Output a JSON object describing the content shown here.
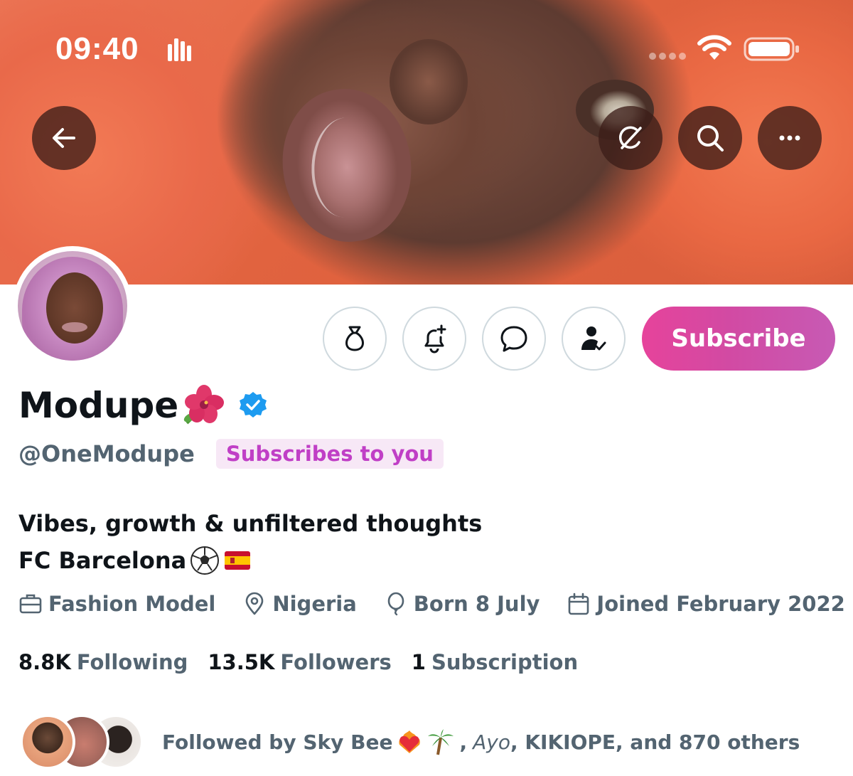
{
  "status_bar": {
    "time": "09:40"
  },
  "header": {
    "back_icon": "arrow-left-icon",
    "actions": [
      "grok-icon",
      "search-icon",
      "more-horizontal-icon"
    ]
  },
  "actions": {
    "tip_icon": "money-bag-icon",
    "notify_icon": "bell-plus-icon",
    "message_icon": "chat-bubble-icon",
    "follow_icon": "person-check-icon",
    "subscribe_label": "Subscribe"
  },
  "profile": {
    "display_name": "Modupe",
    "name_emoji": "hibiscus-icon",
    "verified": true,
    "handle": "@OneModupe",
    "badge": "Subscribes to you",
    "bio_line1": "Vibes, growth & unfiltered thoughts",
    "bio_line2": "FC Barcelona"
  },
  "meta": {
    "profession": "Fashion Model",
    "location": "Nigeria",
    "birthday": "Born 8 July",
    "joined": "Joined February 2022"
  },
  "stats": {
    "following_count": "8.8K",
    "following_label": "Following",
    "followers_count": "13.5K",
    "followers_label": "Followers",
    "subscriptions_count": "1",
    "subscriptions_label": "Subscription"
  },
  "followed_by": {
    "prefix": "Followed by Sky Bee",
    "sep": ",",
    "name2": "Ayo",
    "rest": ", KIKIOPE, and 870 others"
  },
  "colors": {
    "subscribe_start": "#e6439b",
    "subscribe_end": "#c75ab4",
    "badge_text": "#c03fc6",
    "badge_bg": "#f7e8f6",
    "verified_blue": "#1d9bf0",
    "secondary_text": "#536471"
  }
}
